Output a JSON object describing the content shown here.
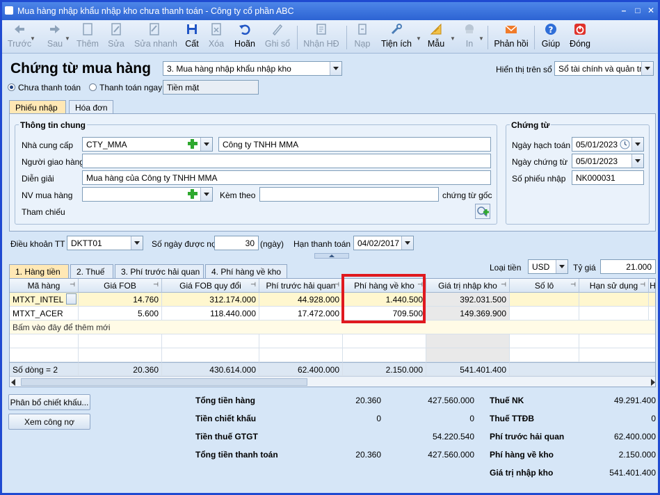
{
  "window": {
    "title": "Mua hàng nhập khẩu nhập kho chưa thanh toán - Công ty cổ phần ABC"
  },
  "toolbar": {
    "items": [
      {
        "label": "Trước",
        "icon": "arrow-left-icon",
        "disabled": true
      },
      {
        "label": "Sau",
        "icon": "arrow-right-icon",
        "disabled": true
      },
      {
        "label": "Thêm",
        "icon": "add-document-icon",
        "disabled": true
      },
      {
        "label": "Sửa",
        "icon": "edit-document-icon",
        "disabled": true
      },
      {
        "label": "Sửa nhanh",
        "icon": "quick-edit-icon",
        "disabled": true
      },
      {
        "label": "Cất",
        "icon": "save-icon",
        "disabled": false
      },
      {
        "label": "Xóa",
        "icon": "delete-icon",
        "disabled": true
      },
      {
        "label": "Hoãn",
        "icon": "undo-icon",
        "disabled": false
      },
      {
        "label": "Ghi sổ",
        "icon": "pen-icon",
        "disabled": true
      },
      {
        "label": "Nhận HĐ",
        "icon": "invoice-icon",
        "disabled": true
      },
      {
        "label": "Nạp",
        "icon": "reload-icon",
        "disabled": true
      },
      {
        "label": "Tiện ích",
        "icon": "tools-icon",
        "disabled": false
      },
      {
        "label": "Mẫu",
        "icon": "template-icon",
        "disabled": false
      },
      {
        "label": "In",
        "icon": "print-icon",
        "disabled": true
      },
      {
        "label": "Phản hồi",
        "icon": "mail-icon",
        "disabled": false
      },
      {
        "label": "Giúp",
        "icon": "help-icon",
        "disabled": false
      },
      {
        "label": "Đóng",
        "icon": "close-power-icon",
        "disabled": false
      }
    ]
  },
  "header": {
    "title": "Chứng từ mua hàng",
    "doc_type": "3. Mua hàng nhập khẩu nhập kho",
    "display_label": "Hiển thị trên sổ",
    "display_value": "Sổ tài chính và quản trị",
    "radio_unpaid": "Chưa thanh toán",
    "radio_paid": "Thanh toán ngay",
    "payment_method": "Tiền mặt"
  },
  "tabs": {
    "receipt": "Phiếu nhập",
    "invoice": "Hóa đơn"
  },
  "general": {
    "title": "Thông tin chung",
    "supplier_label": "Nhà cung cấp",
    "supplier_code": "CTY_MMA",
    "supplier_name": "Công ty TNHH MMA",
    "deliverer_label": "Người giao hàng",
    "deliverer_value": "",
    "desc_label": "Diễn giải",
    "desc_value": "Mua hàng của Công ty TNHH MMA",
    "staff_label": "NV mua hàng",
    "staff_value": "",
    "attach_label": "Kèm theo",
    "attach_value": "",
    "attach_suffix": "chứng từ gốc",
    "ref_label": "Tham chiếu"
  },
  "voucher": {
    "title": "Chứng từ",
    "posting_date_label": "Ngày hạch toán",
    "posting_date": "05/01/2023",
    "voucher_date_label": "Ngày chứng từ",
    "voucher_date": "05/01/2023",
    "receipt_no_label": "Số phiếu nhập",
    "receipt_no": "NK000031"
  },
  "terms": {
    "label": "Điều khoản TT",
    "value": "DKTT01",
    "days_label": "Số ngày được nợ",
    "days_value": "30",
    "days_unit": "(ngày)",
    "due_label": "Hạn thanh toán",
    "due_value": "04/02/2017"
  },
  "detail_tabs": [
    "1. Hàng tiền",
    "2. Thuế",
    "3. Phí trước hải quan",
    "4. Phí hàng về kho"
  ],
  "currency": {
    "label": "Loại tiền",
    "value": "USD",
    "rate_label": "Tỷ giá",
    "rate_value": "21.000"
  },
  "grid": {
    "columns": [
      "Mã hàng",
      "Giá FOB",
      "Giá FOB quy đổi",
      "Phí trước hải quan",
      "Phí hàng về kho",
      "Giá trị nhập kho",
      "Số lô",
      "Hạn sử dụng",
      "H"
    ],
    "rows": [
      [
        "MTXT_INTEL",
        "14.760",
        "312.174.000",
        "44.928.000",
        "1.440.500",
        "392.031.500",
        "",
        ""
      ],
      [
        "MTXT_ACER",
        "5.600",
        "118.440.000",
        "17.472.000",
        "709.500",
        "149.369.900",
        "",
        ""
      ]
    ],
    "add_hint": "Bấm vào đây để thêm mới",
    "footer": [
      "Số dòng = 2",
      "20.360",
      "430.614.000",
      "62.400.000",
      "2.150.000",
      "541.401.400"
    ]
  },
  "buttons": {
    "allocate": "Phân bổ chiết khấu...",
    "debt": "Xem công nợ"
  },
  "summary": {
    "total_goods_label": "Tổng tiền hàng",
    "total_goods_1": "20.360",
    "total_goods_2": "427.560.000",
    "discount_label": "Tiền chiết khấu",
    "discount_1": "0",
    "discount_2": "0",
    "vat_label": "Tiền thuế GTGT",
    "vat_2": "54.220.540",
    "total_pay_label": "Tổng tiền thanh toán",
    "total_pay_1": "20.360",
    "total_pay_2": "427.560.000",
    "import_tax_label": "Thuế NK",
    "import_tax": "49.291.400",
    "special_tax_label": "Thuế TTĐB",
    "special_tax": "0",
    "pre_customs_label": "Phí trước hải quan",
    "pre_customs": "62.400.000",
    "warehouse_fee_label": "Phí hàng về kho",
    "warehouse_fee": "2.150.000",
    "stock_value_label": "Giá trị nhập kho",
    "stock_value": "541.401.400"
  },
  "colors": {
    "highlight": "#e0191f",
    "title_bar": "#2c63d3"
  }
}
